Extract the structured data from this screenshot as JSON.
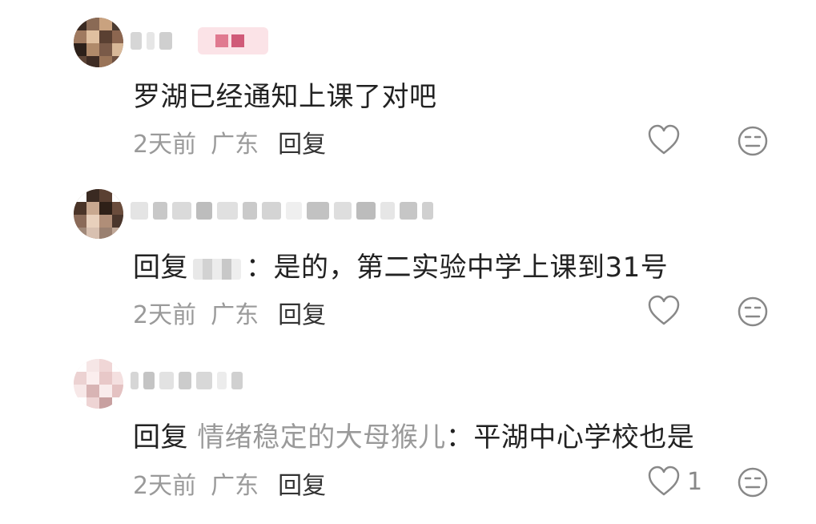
{
  "comments": [
    {
      "text": "罗湖已经通知上课了对吧",
      "meta": {
        "time": "2天前",
        "location": "广东",
        "reply_label": "回复"
      },
      "like_count": ""
    },
    {
      "reply_prefix": "回复",
      "colon": "：",
      "text": "是的，第二实验中学上课到31号",
      "meta": {
        "time": "2天前",
        "location": "广东",
        "reply_label": "回复"
      },
      "like_count": ""
    },
    {
      "reply_prefix": "回复",
      "reply_target": "情绪稳定的大母猴儿",
      "colon": "：",
      "text": "平湖中心学校也是",
      "meta": {
        "time": "2天前",
        "location": "广东",
        "reply_label": "回复"
      },
      "like_count": "1"
    }
  ],
  "icons": {
    "like": "heart-outline-icon",
    "reaction": "neutral-face-icon"
  },
  "colors": {
    "text_primary": "#222222",
    "text_secondary": "#9a9a9a",
    "icon_stroke": "#888888"
  }
}
